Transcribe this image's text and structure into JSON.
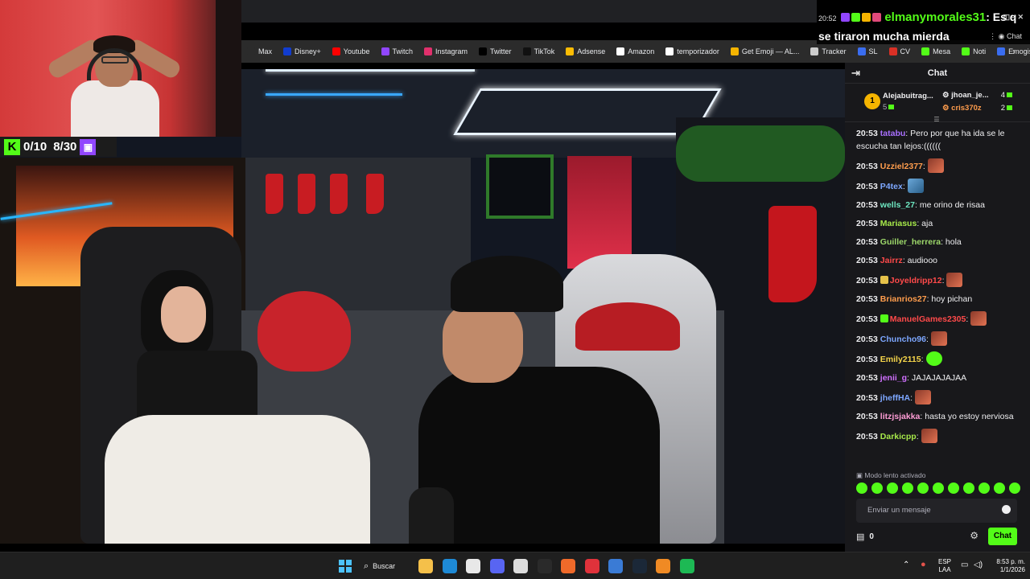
{
  "bookmarks": [
    {
      "label": "Max",
      "icon": "max-icon",
      "color": "#2b2b2b"
    },
    {
      "label": "Disney+",
      "icon": "disney-icon",
      "color": "#113ccf"
    },
    {
      "label": "Youtube",
      "icon": "youtube-icon",
      "color": "#ff0000"
    },
    {
      "label": "Twitch",
      "icon": "twitch-icon",
      "color": "#9146ff"
    },
    {
      "label": "Instagram",
      "icon": "instagram-icon",
      "color": "#e1306c"
    },
    {
      "label": "Twitter",
      "icon": "twitter-icon",
      "color": "#000000"
    },
    {
      "label": "TikTok",
      "icon": "tiktok-icon",
      "color": "#111111"
    },
    {
      "label": "Adsense",
      "icon": "adsense-icon",
      "color": "#fbbc04"
    },
    {
      "label": "Amazon",
      "icon": "amazon-icon",
      "color": "#ffffff"
    },
    {
      "label": "temporizador",
      "icon": "timer-icon",
      "color": "#ffffff"
    },
    {
      "label": "Get Emoji — AL...",
      "icon": "emoji-icon",
      "color": "#f5b400"
    },
    {
      "label": "Tracker",
      "icon": "tracker-icon",
      "color": "#cccccc"
    },
    {
      "label": "SL",
      "icon": "sl-icon",
      "color": "#3a6df0"
    },
    {
      "label": "CV",
      "icon": "cv-icon",
      "color": "#d93025"
    },
    {
      "label": "Mesa",
      "icon": "kick-icon",
      "color": "#53fc18"
    },
    {
      "label": "Noti",
      "icon": "kick-icon",
      "color": "#53fc18"
    },
    {
      "label": "Emogis",
      "icon": "emogis-icon",
      "color": "#3a6df0"
    }
  ],
  "counter": {
    "kick_score": "0/10",
    "twitch_score": "8/30",
    "kick_letter": "K"
  },
  "overlay_chat": {
    "time": "20:52",
    "username": "elmanymorales31",
    "message_line1": ": Es q",
    "message_line2": "se tiraron mucha mierda",
    "chat_label": "Chat"
  },
  "chat": {
    "title": "Chat",
    "leaderboard": {
      "first_rank": "1",
      "first_name": "Alejabuitrag...",
      "first_points": "5",
      "second_name": "jhoan_je...",
      "second_points": "4",
      "third_name": "cris370z",
      "third_points": "2"
    },
    "messages": [
      {
        "time": "20:53",
        "user": "tatabu",
        "color": "#a970ff",
        "text": ": Pero por que ha ida se le escucha tan lejos:(((((( ",
        "emote": ""
      },
      {
        "time": "20:53",
        "user": "Uzziel2377",
        "color": "#ff9d4d",
        "text": ":",
        "emote": "face"
      },
      {
        "time": "20:53",
        "user": "P4tex",
        "color": "#7da7ff",
        "text": ":",
        "emote": "blue"
      },
      {
        "time": "20:53",
        "user": "wells_27",
        "color": "#6ee8c2",
        "text": ": me orino de risaa",
        "emote": ""
      },
      {
        "time": "20:53",
        "user": "Mariasus",
        "color": "#a6e84a",
        "text": ": aja",
        "emote": ""
      },
      {
        "time": "20:53",
        "user": "Guiller_herrera",
        "color": "#9dd86a",
        "text": ": hola",
        "emote": ""
      },
      {
        "time": "20:53",
        "user": "Jairrz",
        "color": "#ff4a4a",
        "text": ": audiooo",
        "emote": ""
      },
      {
        "time": "20:53",
        "user": "Joyeldripp12",
        "color": "#ff4a4a",
        "text": ":",
        "emote": "face",
        "badge": "gold"
      },
      {
        "time": "20:53",
        "user": "Brianrios27",
        "color": "#ff9d4d",
        "text": ": hoy pichan",
        "emote": ""
      },
      {
        "time": "20:53",
        "user": "ManuelGames2305",
        "color": "#ff4a4a",
        "text": ":",
        "emote": "face",
        "badge": "green"
      },
      {
        "time": "20:53",
        "user": "Chuncho96",
        "color": "#7da7ff",
        "text": ":",
        "emote": "face"
      },
      {
        "time": "20:53",
        "user": "Emily2115",
        "color": "#f5d54a",
        "text": ":",
        "emote": "green"
      },
      {
        "time": "20:53",
        "user": "jenii_g",
        "color": "#d070ff",
        "text": ": JAJAJAJAJAA",
        "emote": ""
      },
      {
        "time": "20:53",
        "user": "jheffHA",
        "color": "#7da7ff",
        "text": ":",
        "emote": "face"
      },
      {
        "time": "20:53",
        "user": "litzjsjakka",
        "color": "#ff9dd6",
        "text": ": hasta yo estoy nerviosa",
        "emote": ""
      },
      {
        "time": "20:53",
        "user": "Darkicpp",
        "color": "#a6e84a",
        "text": ":",
        "emote": "face"
      }
    ],
    "slow_mode": "Modo lento activado",
    "input_placeholder": "Enviar un mensaje",
    "points": "0",
    "send_label": "Chat"
  },
  "taskbar": {
    "search_label": "Buscar",
    "lang_line1": "ESP",
    "lang_line2": "LAA",
    "time": "8:53 p. m.",
    "date": "1/1/2026",
    "apps": [
      {
        "name": "file-explorer-icon",
        "color": "#f5c04a"
      },
      {
        "name": "edge-icon",
        "color": "#1e8ad6"
      },
      {
        "name": "app-icon",
        "color": "#e8e8e8"
      },
      {
        "name": "discord-icon",
        "color": "#5865f2"
      },
      {
        "name": "chrome-icon",
        "color": "#dddddd"
      },
      {
        "name": "epic-games-icon",
        "color": "#2a2a2a"
      },
      {
        "name": "origin-icon",
        "color": "#f06a2a"
      },
      {
        "name": "record-icon",
        "color": "#e0323b"
      },
      {
        "name": "app-blue-icon",
        "color": "#3a7bd5"
      },
      {
        "name": "steam-icon",
        "color": "#1b2838"
      },
      {
        "name": "vlc-icon",
        "color": "#f08a24"
      },
      {
        "name": "spotify-icon",
        "color": "#1db954"
      }
    ]
  }
}
